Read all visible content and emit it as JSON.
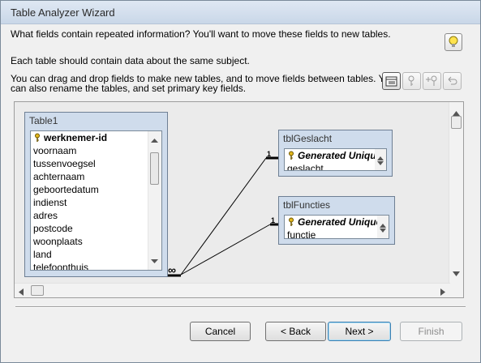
{
  "window": {
    "title": "Table Analyzer Wizard"
  },
  "instructions": {
    "line1": "What fields contain repeated information? You'll want to move these fields to new tables.",
    "line2": "Each table should contain data about the same subject.",
    "line3": "You can drag and drop fields to make new tables, and to move fields between tables. You",
    "line4": "can also rename the tables, and set primary key fields."
  },
  "toolbar": {
    "icons": [
      "rename-table-icon",
      "set-primary-key-icon",
      "add-generated-key-icon",
      "undo-icon"
    ]
  },
  "tables": {
    "table1": {
      "title": "Table1",
      "key_field": "werknemer-id",
      "fields": [
        "voornaam",
        "tussenvoegsel",
        "achternaam",
        "geboortedatum",
        "indienst",
        "adres",
        "postcode",
        "woonplaats",
        "land",
        "telefoonthuis"
      ]
    },
    "geslacht": {
      "title": "tblGeslacht",
      "key_field": "Generated Unique",
      "field": "geslacht"
    },
    "functies": {
      "title": "tblFuncties",
      "key_field": "Generated Unique",
      "field": "functie"
    }
  },
  "relations": {
    "one_label": "1",
    "many_label": "∞"
  },
  "buttons": {
    "cancel": "Cancel",
    "back": "< Back",
    "next": "Next >",
    "finish": "Finish"
  },
  "colors": {
    "table_header": "#cfdcec",
    "canvas": "#ebebeb",
    "default_button_border": "#3c7fb1"
  }
}
